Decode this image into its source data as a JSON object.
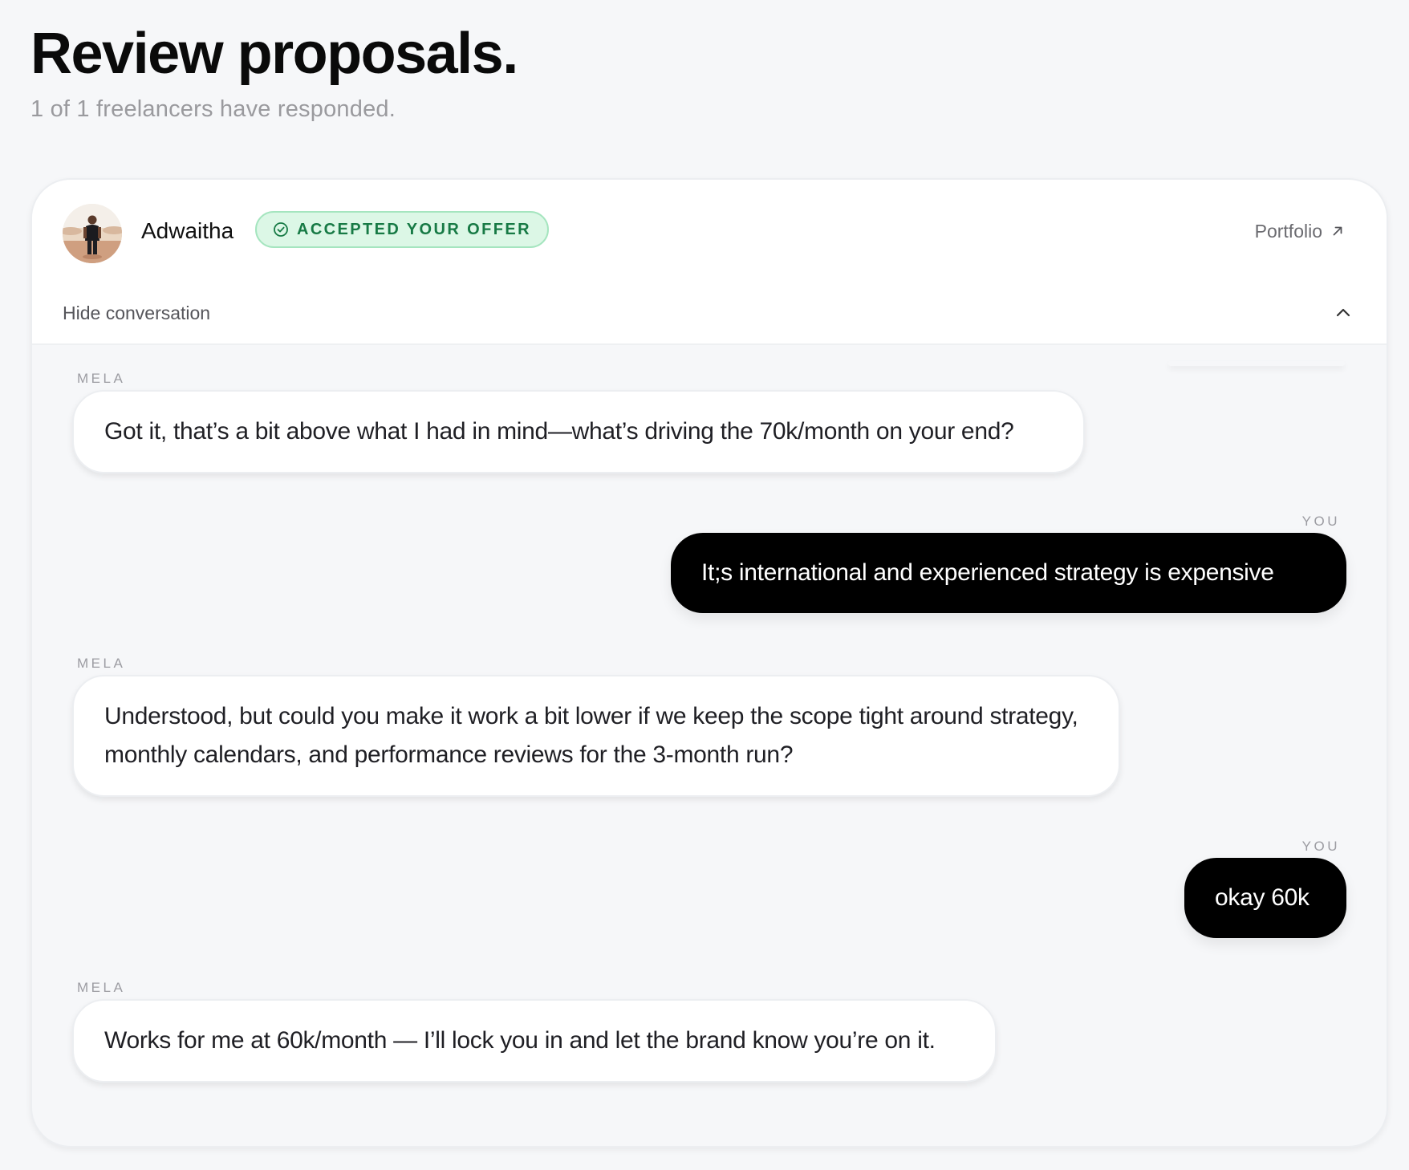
{
  "page": {
    "title": "Review proposals.",
    "subtitle": "1 of 1 freelancers have responded."
  },
  "proposal": {
    "freelancer_name": "Adwaitha",
    "status_badge": "ACCEPTED YOUR OFFER",
    "status_color": "#177a45",
    "status_bg": "#dcf7e6",
    "portfolio_label": "Portfolio",
    "portfolio_icon": "arrow-up-right-icon",
    "toggle_label": "Hide conversation",
    "toggle_icon": "chevron-up-icon"
  },
  "conversation": {
    "messages": [
      {
        "sender": "MELA",
        "direction": "in",
        "text": "Got it, that’s a bit above what I had in mind—what’s driving the 70k/month on your end?"
      },
      {
        "sender": "YOU",
        "direction": "out",
        "text": "It;s international and experienced strategy is expensive"
      },
      {
        "sender": "MELA",
        "direction": "in",
        "text": "Understood, but could you make it work a bit lower if we keep the scope tight around strategy, monthly calendars, and performance reviews for the 3-month run?"
      },
      {
        "sender": "YOU",
        "direction": "out",
        "text": "okay 60k"
      },
      {
        "sender": "MELA",
        "direction": "in",
        "text": "Works for me at 60k/month — I’ll lock you in and let the brand know you’re on it."
      }
    ]
  },
  "colors": {
    "background": "#f6f7f9",
    "outgoing_bubble": "#000000",
    "incoming_bubble": "#ffffff"
  }
}
